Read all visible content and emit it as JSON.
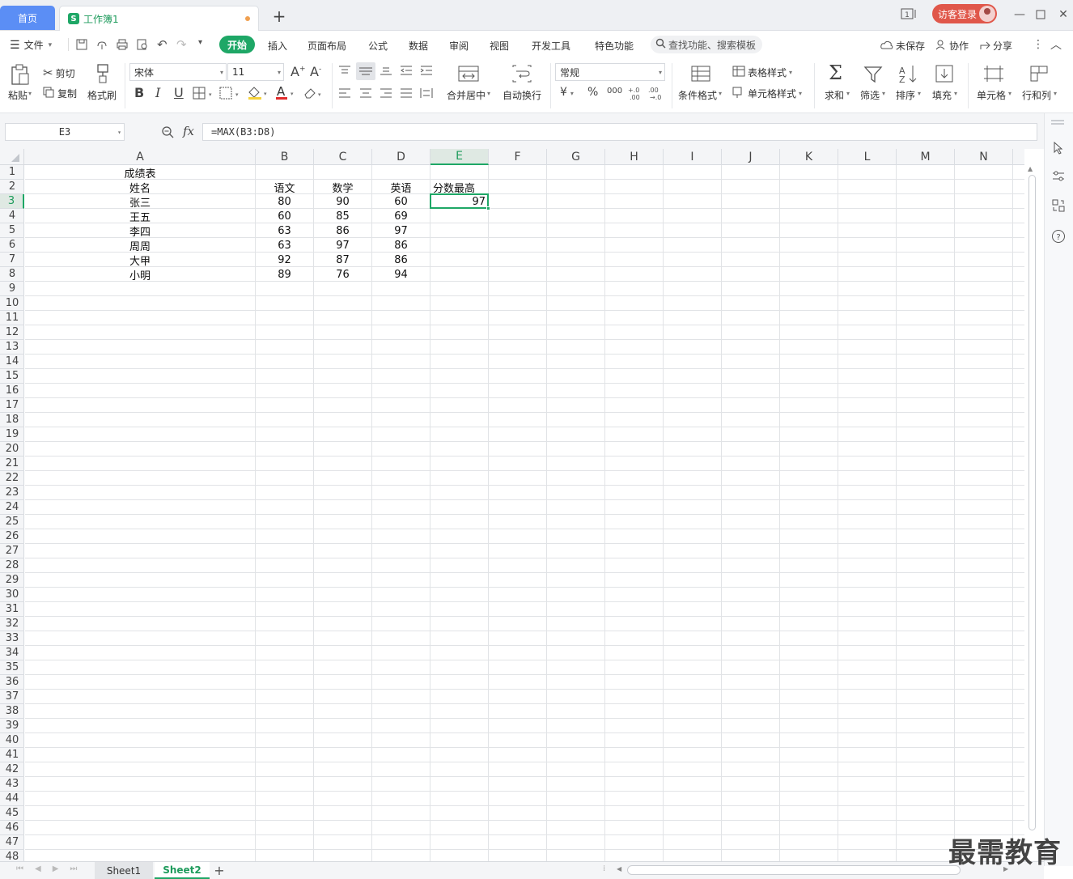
{
  "titlebar": {
    "home_tab": "首页",
    "book_tab": "工作簿1",
    "new_tab": "+",
    "guest_login": "访客登录"
  },
  "menu": {
    "file": "文件",
    "tabs": [
      "开始",
      "插入",
      "页面布局",
      "公式",
      "数据",
      "审阅",
      "视图",
      "开发工具",
      "特色功能"
    ],
    "search": "查找功能、搜索模板",
    "unsaved": "未保存",
    "collab": "协作",
    "share": "分享"
  },
  "ribbon": {
    "paste": "粘贴",
    "cut": "剪切",
    "copy": "复制",
    "format_painter": "格式刷",
    "font_name": "宋体",
    "font_size": "11",
    "merge_center": "合并居中",
    "wrap_text": "自动换行",
    "number_format": "常规",
    "currency": "¥",
    "percent": "%",
    "cond_format": "条件格式",
    "table_style": "表格样式",
    "cell_style": "单元格样式",
    "sum": "求和",
    "filter": "筛选",
    "sort": "排序",
    "fill": "填充",
    "cell": "单元格",
    "row_col": "行和列"
  },
  "formula_bar": {
    "name_box": "E3",
    "fx": "fx",
    "formula": "=MAX(B3:D8)"
  },
  "grid": {
    "columns": [
      "A",
      "B",
      "C",
      "D",
      "E",
      "F",
      "G",
      "H",
      "I",
      "J",
      "K",
      "L",
      "M",
      "N"
    ],
    "selected_column": "E",
    "selected_row": 3,
    "row_count": 48,
    "cells": [
      {
        "ref": "A1",
        "value": "成绩表",
        "align": "center"
      },
      {
        "ref": "A2",
        "value": "姓名",
        "align": "center"
      },
      {
        "ref": "B2",
        "value": "语文",
        "align": "center"
      },
      {
        "ref": "C2",
        "value": "数学",
        "align": "center"
      },
      {
        "ref": "D2",
        "value": "英语",
        "align": "center"
      },
      {
        "ref": "E2",
        "value": "分数最高",
        "align": "left"
      },
      {
        "ref": "A3",
        "value": "张三",
        "align": "center"
      },
      {
        "ref": "B3",
        "value": "80",
        "align": "center"
      },
      {
        "ref": "C3",
        "value": "90",
        "align": "center"
      },
      {
        "ref": "D3",
        "value": "60",
        "align": "center"
      },
      {
        "ref": "E3",
        "value": "97",
        "align": "right"
      },
      {
        "ref": "A4",
        "value": "王五",
        "align": "center"
      },
      {
        "ref": "B4",
        "value": "60",
        "align": "center"
      },
      {
        "ref": "C4",
        "value": "85",
        "align": "center"
      },
      {
        "ref": "D4",
        "value": "69",
        "align": "center"
      },
      {
        "ref": "A5",
        "value": "李四",
        "align": "center"
      },
      {
        "ref": "B5",
        "value": "63",
        "align": "center"
      },
      {
        "ref": "C5",
        "value": "86",
        "align": "center"
      },
      {
        "ref": "D5",
        "value": "97",
        "align": "center"
      },
      {
        "ref": "A6",
        "value": "周周",
        "align": "center"
      },
      {
        "ref": "B6",
        "value": "63",
        "align": "center"
      },
      {
        "ref": "C6",
        "value": "97",
        "align": "center"
      },
      {
        "ref": "D6",
        "value": "86",
        "align": "center"
      },
      {
        "ref": "A7",
        "value": "大甲",
        "align": "center"
      },
      {
        "ref": "B7",
        "value": "92",
        "align": "center"
      },
      {
        "ref": "C7",
        "value": "87",
        "align": "center"
      },
      {
        "ref": "D7",
        "value": "86",
        "align": "center"
      },
      {
        "ref": "A8",
        "value": "小明",
        "align": "center"
      },
      {
        "ref": "B8",
        "value": "89",
        "align": "center"
      },
      {
        "ref": "C8",
        "value": "76",
        "align": "center"
      },
      {
        "ref": "D8",
        "value": "94",
        "align": "center"
      }
    ]
  },
  "sheets": {
    "tabs": [
      "Sheet1",
      "Sheet2"
    ],
    "active": "Sheet2",
    "add": "+"
  },
  "watermark": "最需教育",
  "colors": {
    "accent": "#1ea766",
    "home_tab": "#5b8ef5",
    "guest": "#e0574a"
  }
}
